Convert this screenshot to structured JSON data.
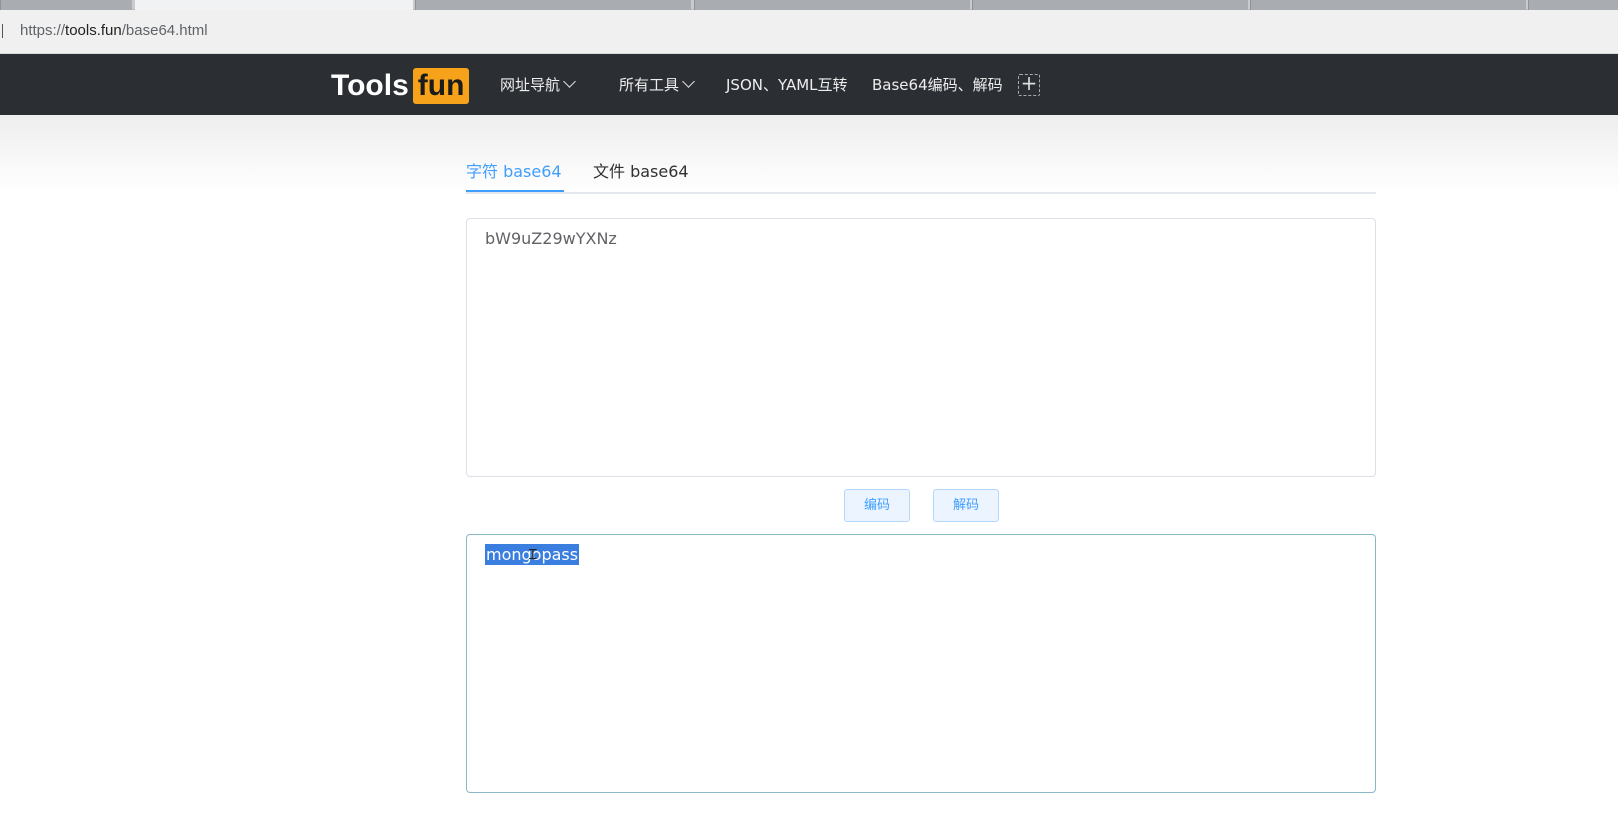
{
  "browser": {
    "url_scheme": "https://",
    "url_host": "tools.fun",
    "url_path": "/base64.html"
  },
  "header": {
    "logo_primary": "Tools",
    "logo_accent": "fun",
    "nav": [
      {
        "label": "网址导航",
        "has_dropdown": true
      },
      {
        "label": "所有工具",
        "has_dropdown": true
      },
      {
        "label": "JSON、YAML互转",
        "has_dropdown": false
      },
      {
        "label": "Base64编码、解码",
        "has_dropdown": false
      }
    ],
    "add_icon": "plus-icon",
    "add_symbol": "+"
  },
  "tabs": [
    {
      "label": "字符 base64",
      "active": true
    },
    {
      "label": "文件 base64",
      "active": false
    }
  ],
  "input": {
    "value": "bW9uZ29wYXNz"
  },
  "buttons": {
    "encode": "编码",
    "decode": "解码"
  },
  "output": {
    "value": "mongopass",
    "selected": true
  },
  "colors": {
    "header_bg": "#2b2e33",
    "logo_accent_bg": "#f7a21b",
    "primary": "#409eff",
    "selection": "#3a7fe0"
  }
}
